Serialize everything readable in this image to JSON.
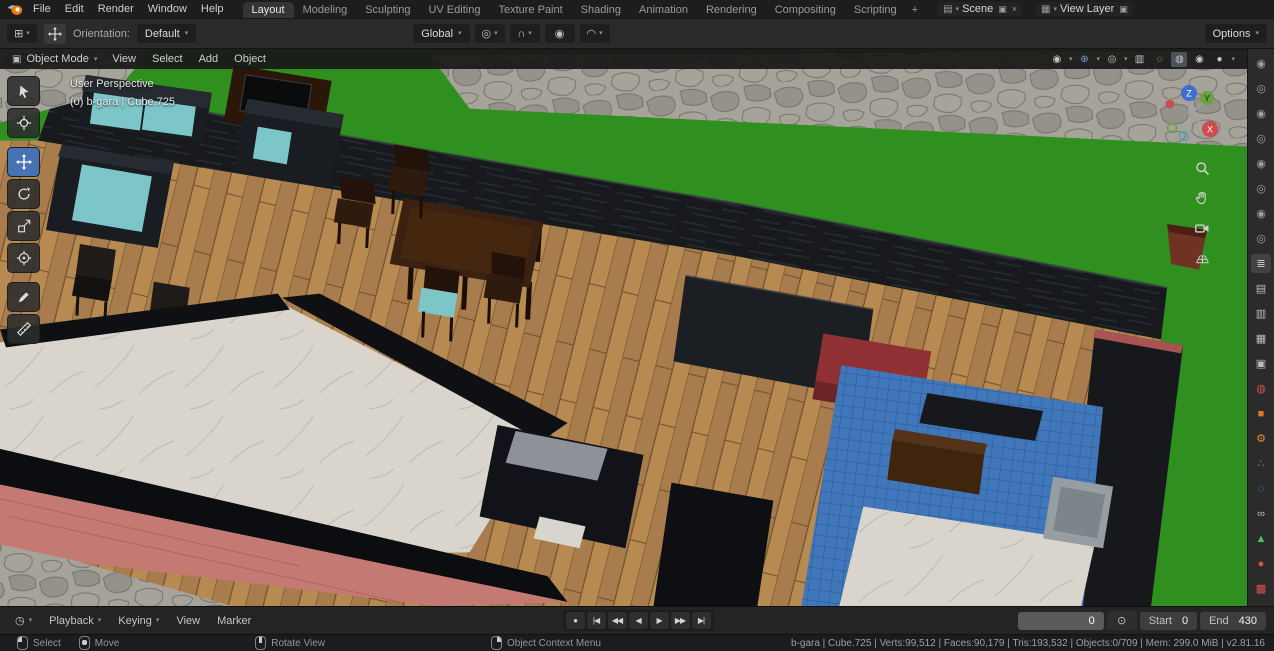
{
  "topbar": {
    "menus": [
      "File",
      "Edit",
      "Render",
      "Window",
      "Help"
    ],
    "tabs": [
      "Layout",
      "Modeling",
      "Sculpting",
      "UV Editing",
      "Texture Paint",
      "Shading",
      "Animation",
      "Rendering",
      "Compositing",
      "Scripting"
    ],
    "add_tab_label": "+",
    "scene_label": "Scene",
    "view_layer_label": "View Layer"
  },
  "tool_settings": {
    "orientation_label": "Orientation:",
    "orientation_value": "Default",
    "transform_orientation": "Global",
    "options_label": "Options"
  },
  "viewport": {
    "header": {
      "mode": "Object Mode",
      "menus": [
        "View",
        "Select",
        "Add",
        "Object"
      ],
      "right_icons": [
        {
          "name": "object-type-visibility",
          "glyph": "◉",
          "dropdown": true
        },
        {
          "name": "show-gizmos",
          "glyph": "⊕",
          "color": "#6f9fd8",
          "dropdown": true
        },
        {
          "name": "show-overlays",
          "glyph": "◎",
          "dropdown": true
        },
        {
          "name": "toggle-xray",
          "glyph": "▥"
        },
        {
          "name": "shading-wireframe",
          "glyph": "◌"
        },
        {
          "name": "shading-solid",
          "glyph": "◍",
          "active": true
        },
        {
          "name": "shading-material",
          "glyph": "◉"
        },
        {
          "name": "shading-rendered",
          "glyph": "●",
          "dropdown": true
        }
      ]
    },
    "overlay": {
      "perspective": "User Perspective",
      "active_object": "(0) b-gara | Cube.725"
    },
    "gizmo_axes": {
      "x": "X",
      "y": "Y",
      "z": "Z"
    }
  },
  "right_strip": {
    "icons": [
      {
        "name": "restrict-render",
        "glyph": "◉",
        "color": "#9f9f9f"
      },
      {
        "name": "restrict-viewport",
        "glyph": "◎",
        "color": "#9f9f9f"
      },
      {
        "name": "restrict-select",
        "glyph": "◉",
        "color": "#9f9f9f"
      },
      {
        "name": "filter-collection",
        "glyph": "◎",
        "color": "#9f9f9f"
      },
      {
        "name": "filter-object",
        "glyph": "◉",
        "color": "#9f9f9f"
      },
      {
        "name": "filter-mesh",
        "glyph": "◎",
        "color": "#9f9f9f"
      },
      {
        "name": "filter-light",
        "glyph": "◉",
        "color": "#9f9f9f"
      },
      {
        "name": "filter-camera",
        "glyph": "◎",
        "color": "#9f9f9f"
      },
      {
        "name": "properties-tool",
        "glyph": "≣",
        "color": "#d6d6d6",
        "active": true
      },
      {
        "name": "properties-render",
        "glyph": "▤",
        "color": "#bdbdbd"
      },
      {
        "name": "properties-output",
        "glyph": "▥",
        "color": "#bdbdbd"
      },
      {
        "name": "properties-view-layer",
        "glyph": "▦",
        "color": "#bdbdbd"
      },
      {
        "name": "properties-scene",
        "glyph": "▣",
        "color": "#bdbdbd"
      },
      {
        "name": "properties-world",
        "glyph": "◍",
        "color": "#d7504a"
      },
      {
        "name": "properties-object",
        "glyph": "■",
        "color": "#e0762c"
      },
      {
        "name": "properties-modifiers",
        "glyph": "⚙",
        "color": "#e0882c"
      },
      {
        "name": "properties-particles",
        "glyph": "∴",
        "color": "#4a90d9"
      },
      {
        "name": "properties-physics",
        "glyph": "◌",
        "color": "#4a90d9"
      },
      {
        "name": "properties-constraints",
        "glyph": "∞",
        "color": "#bdbdbd"
      },
      {
        "name": "properties-object-data",
        "glyph": "▲",
        "color": "#4fbf64"
      },
      {
        "name": "properties-material",
        "glyph": "●",
        "color": "#d7504a"
      },
      {
        "name": "properties-texture",
        "glyph": "▩",
        "color": "#d7504a"
      }
    ]
  },
  "timeline": {
    "menus": [
      "Playback",
      "Keying",
      "View",
      "Marker"
    ],
    "controls": [
      {
        "name": "auto-keying",
        "glyph": "●"
      },
      {
        "name": "jump-to-start",
        "glyph": "|◀"
      },
      {
        "name": "jump-to-prev-keyframe",
        "glyph": "◀◀"
      },
      {
        "name": "play-reverse",
        "glyph": "◀"
      },
      {
        "name": "play",
        "glyph": "▶"
      },
      {
        "name": "jump-to-next-keyframe",
        "glyph": "▶▶"
      },
      {
        "name": "jump-to-end",
        "glyph": "▶|"
      }
    ],
    "current_frame": "0",
    "start_label": "Start",
    "start_value": "0",
    "end_label": "End",
    "end_value": "430"
  },
  "statusbar": {
    "hints": [
      "Select",
      "Move",
      "Rotate View",
      "Object Context Menu"
    ],
    "info": "b-gara | Cube.725 | Verts:99,512 | Faces:90,179 | Tris:193,532 | Objects:0/709 | Mem: 299.0 MiB | v2.81.16"
  },
  "colors": {
    "accent": "#4772b3",
    "grass": "#2f8f1f",
    "stone": "#a6a49a",
    "stone_dark": "#94928a",
    "stone_line": "#75746c",
    "wall": "#17191d",
    "wall_hi": "#353b42",
    "wood": "#a87c4d",
    "wood_2": "#b78a52",
    "wood_seam": "#6f4e2c",
    "marble": "#d9d5cd",
    "marble_vein": "#b7b1a7",
    "teal": "#7cc5c8",
    "frame": "#191c20",
    "tbl": "#3a2112",
    "tile": "#4077bb",
    "tile_line": "#2d5c99",
    "red": "#8e3034",
    "pink": "#c47a72"
  }
}
